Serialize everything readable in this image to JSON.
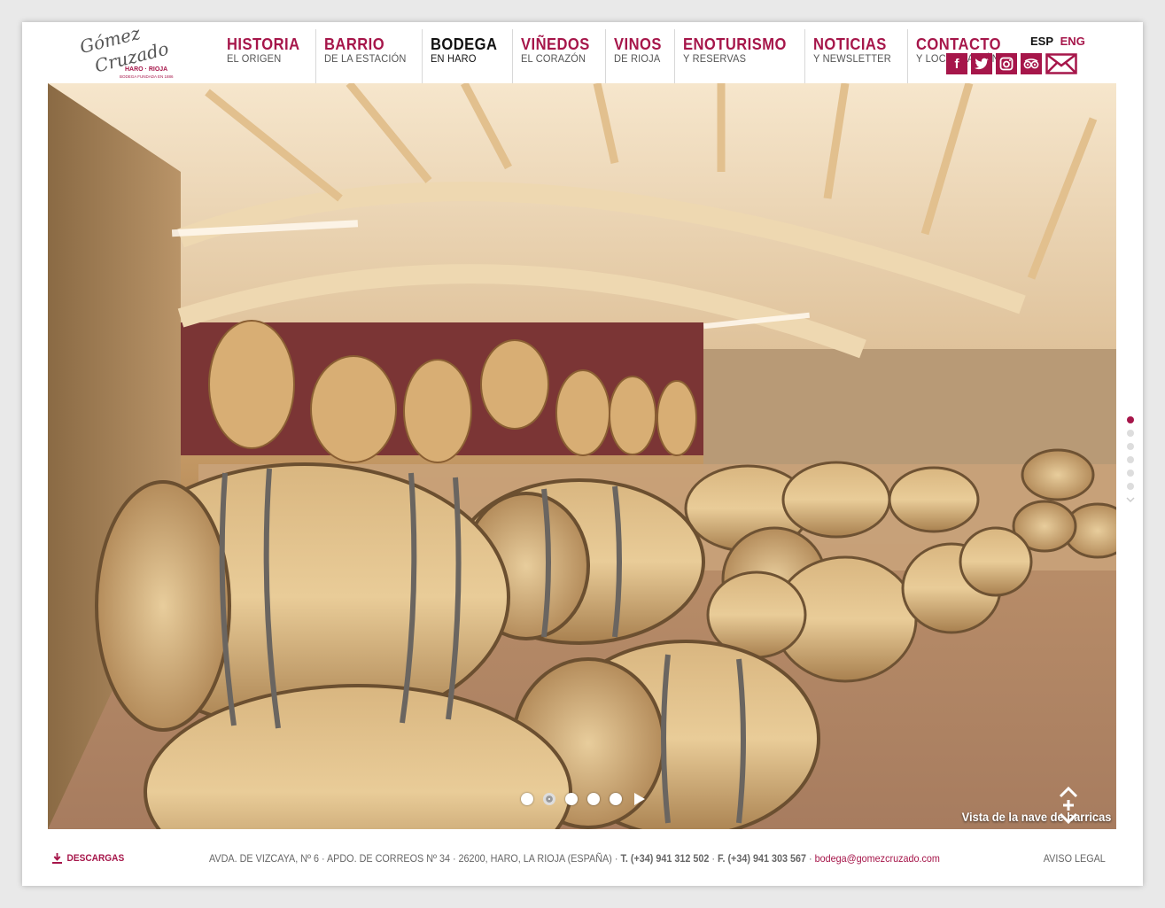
{
  "brand": {
    "logo_line1": "Gómez",
    "logo_line2": "Cruzado",
    "logo_tagline": "HARO · RIOJA",
    "logo_founded": "BODEGA FUNDADA EN 1886",
    "accent_color": "#a6164a"
  },
  "nav": [
    {
      "title": "HISTORIA",
      "sub": "EL ORIGEN"
    },
    {
      "title": "BARRIO",
      "sub": "DE LA ESTACIÓN"
    },
    {
      "title": "BODEGA",
      "sub": "EN HARO"
    },
    {
      "title": "VIÑEDOS",
      "sub": "EL CORAZÓN"
    },
    {
      "title": "VINOS",
      "sub": "DE RIOJA"
    },
    {
      "title": "ENOTURISMO",
      "sub": "Y RESERVAS"
    },
    {
      "title": "NOTICIAS",
      "sub": "Y NEWSLETTER"
    },
    {
      "title": "CONTACTO",
      "sub": "Y LOCALIZACIÓN"
    }
  ],
  "active_nav": "BODEGA",
  "lang": {
    "esp": "ESP",
    "eng": "ENG"
  },
  "social": [
    "facebook-icon",
    "twitter-icon",
    "instagram-icon",
    "tripadvisor-icon",
    "mail-icon"
  ],
  "hero": {
    "caption": "Vista de la nave de barricas",
    "slides": 5,
    "active_slide": 2
  },
  "side_pager": {
    "pages": 6,
    "active_page": 1
  },
  "footer": {
    "downloads": "DESCARGAS",
    "address": "AVDA. DE VIZCAYA, Nº 6 · APDO. DE CORREOS Nº 34 · 26200, HARO, LA RIOJA (ESPAÑA)",
    "phone": "T. (+34) 941 312 502",
    "fax": "F. (+34) 941 303 567",
    "email": "bodega@gomezcruzado.com",
    "legal": "AVISO LEGAL"
  }
}
